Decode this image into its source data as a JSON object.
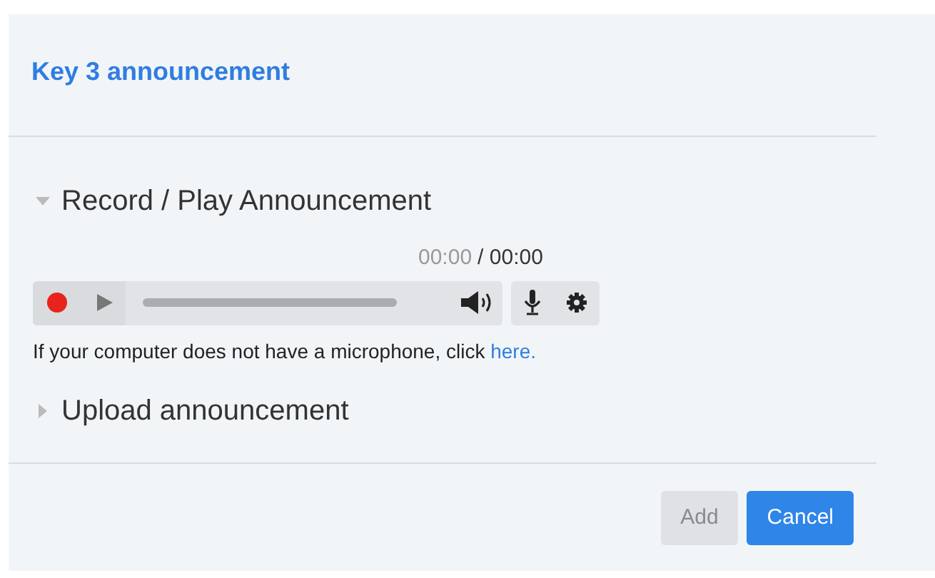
{
  "dialog": {
    "title": "Key 3 announcement"
  },
  "sections": [
    {
      "title": "Record / Play Announcement",
      "expanded": true,
      "player": {
        "elapsed": "00:00",
        "total": "/ 00:00"
      },
      "hint": {
        "text": "If your computer does not have a microphone, click",
        "link": "here."
      }
    },
    {
      "title": "Upload announcement",
      "expanded": false
    }
  ],
  "buttons": [
    {
      "label": "Add",
      "disabled": true
    },
    {
      "label": "Cancel",
      "disabled": false
    }
  ]
}
